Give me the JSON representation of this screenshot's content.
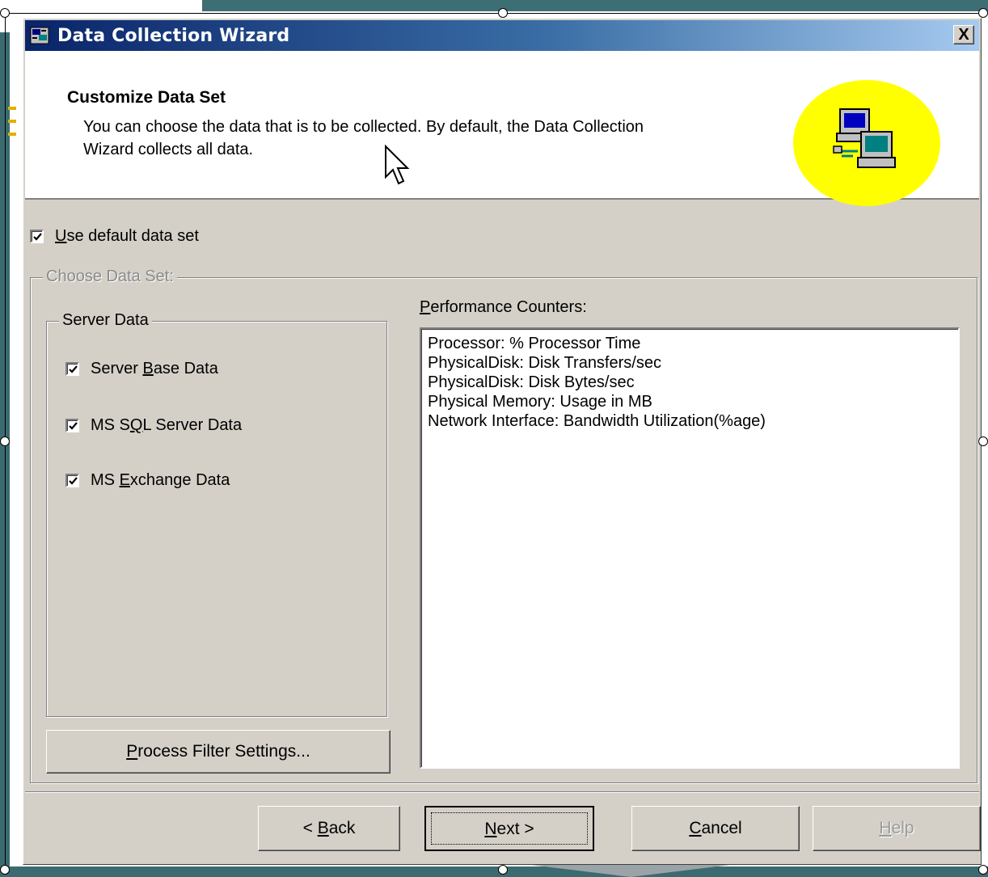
{
  "window": {
    "title": "Data Collection Wizard",
    "close_label": "X"
  },
  "header": {
    "title": "Customize Data Set",
    "description": "You can choose the data that is to be collected. By default, the Data Collection Wizard collects all data.",
    "graphic_icon": "network-computers-icon",
    "graphic_color": "#ffff00"
  },
  "use_default": {
    "label_u": "U",
    "label_rest": "se default data set",
    "checked": true
  },
  "choose_group": {
    "legend": "Choose Data Set:"
  },
  "server_group": {
    "legend": "Server Data",
    "items": [
      {
        "pre": "Server ",
        "u": "B",
        "post": "ase Data",
        "checked": true
      },
      {
        "pre": "MS S",
        "u": "Q",
        "post": "L Server Data",
        "checked": true
      },
      {
        "pre": "MS ",
        "u": "E",
        "post": "xchange Data",
        "checked": true
      }
    ]
  },
  "performance": {
    "label_u": "P",
    "label_rest": "erformance Counters:",
    "counters": [
      "Processor: % Processor Time",
      "PhysicalDisk: Disk Transfers/sec",
      "PhysicalDisk: Disk Bytes/sec",
      "Physical Memory: Usage in MB",
      "Network Interface: Bandwidth Utilization(%age)"
    ]
  },
  "buttons": {
    "process_filter": {
      "u": "P",
      "rest": "rocess Filter Settings..."
    },
    "back": {
      "pre": "< ",
      "u": "B",
      "rest": "ack"
    },
    "next": {
      "u": "N",
      "rest": "ext >"
    },
    "cancel": {
      "u": "C",
      "rest": "ancel"
    },
    "help": {
      "u": "H",
      "rest": "elp"
    }
  }
}
